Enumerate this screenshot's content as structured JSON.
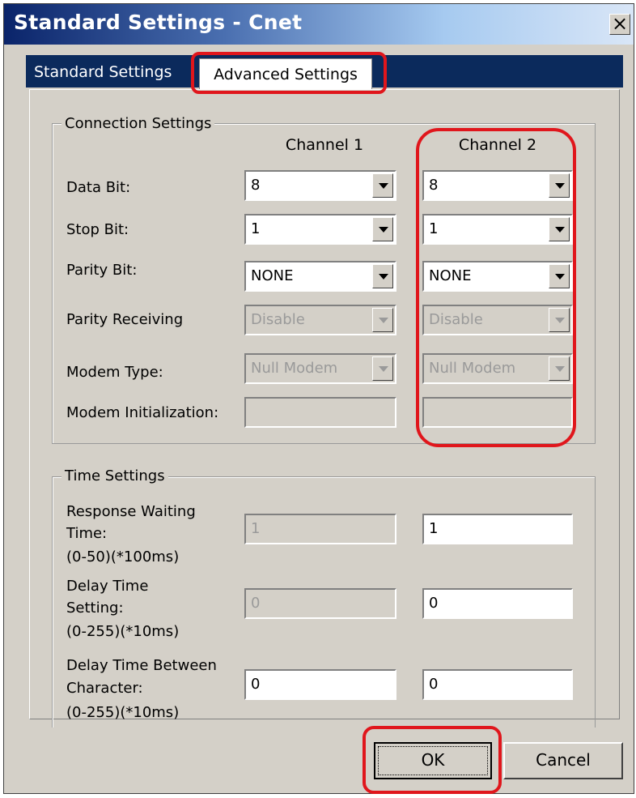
{
  "window": {
    "title": "Standard Settings - Cnet",
    "close_label": "×"
  },
  "tabs": [
    {
      "label": "Standard Settings"
    },
    {
      "label": "Advanced Settings"
    }
  ],
  "connection": {
    "legend": "Connection Settings",
    "channel_headers": [
      "Channel 1",
      "Channel 2"
    ],
    "labels": {
      "data_bit": "Data Bit:",
      "stop_bit": "Stop Bit:",
      "parity_bit": "Parity Bit:",
      "parity_receiving": "Parity Receiving",
      "modem_type": "Modem Type:",
      "modem_init": "Modem Initialization:"
    },
    "ch1": {
      "data_bit": "8",
      "stop_bit": "1",
      "parity_bit": "NONE",
      "parity_receiving": "Disable",
      "modem_type": "Null Modem",
      "modem_init": ""
    },
    "ch2": {
      "data_bit": "8",
      "stop_bit": "1",
      "parity_bit": "NONE",
      "parity_receiving": "Disable",
      "modem_type": "Null Modem",
      "modem_init": ""
    }
  },
  "time": {
    "legend": "Time Settings",
    "response_label_1": "Response Waiting",
    "response_label_2": "Time:",
    "response_range": "(0-50)(*100ms)",
    "delay_label_1": "Delay Time",
    "delay_label_2": "Setting:",
    "delay_range": "(0-255)(*10ms)",
    "between_label_1": "Delay Time Between",
    "between_label_2": "Character:",
    "between_range": "(0-255)(*10ms)",
    "ch1": {
      "response": "1",
      "delay": "0",
      "between": "0"
    },
    "ch2": {
      "response": "1",
      "delay": "0",
      "between": "0"
    }
  },
  "buttons": {
    "ok": "OK",
    "cancel": "Cancel"
  },
  "colors": {
    "highlight": "#e0161c",
    "titlebar_start": "#0a246a",
    "dialog_bg": "#d4d0c8"
  }
}
